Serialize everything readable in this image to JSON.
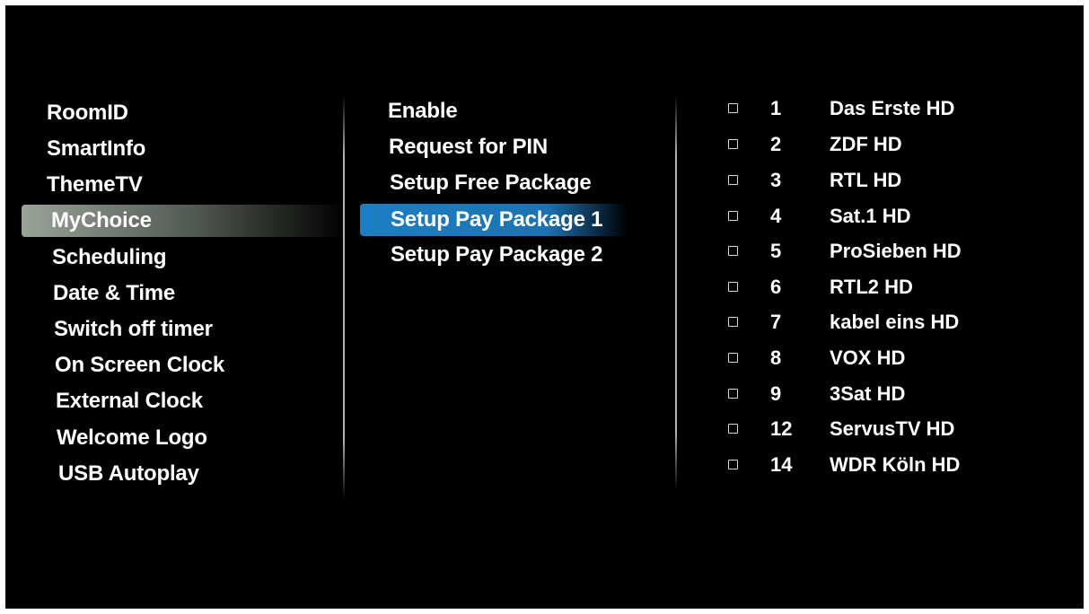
{
  "settings_menu": {
    "items": [
      {
        "label": "RoomID"
      },
      {
        "label": "SmartInfo"
      },
      {
        "label": "ThemeTV"
      },
      {
        "label": "MyChoice",
        "selected": true
      },
      {
        "label": "Scheduling"
      },
      {
        "label": "Date & Time"
      },
      {
        "label": "Switch off timer"
      },
      {
        "label": "On Screen Clock"
      },
      {
        "label": "External Clock"
      },
      {
        "label": "Welcome Logo"
      },
      {
        "label": "USB Autoplay"
      }
    ]
  },
  "mychoice_menu": {
    "items": [
      {
        "label": "Enable"
      },
      {
        "label": "Request for PIN"
      },
      {
        "label": "Setup Free Package"
      },
      {
        "label": "Setup Pay Package 1",
        "selected": true
      },
      {
        "label": "Setup Pay Package 2"
      }
    ]
  },
  "channel_list": {
    "channels": [
      {
        "number": "1",
        "name": "Das Erste HD",
        "checked": false
      },
      {
        "number": "2",
        "name": "ZDF HD",
        "checked": false
      },
      {
        "number": "3",
        "name": "RTL HD",
        "checked": false
      },
      {
        "number": "4",
        "name": "Sat.1 HD",
        "checked": false
      },
      {
        "number": "5",
        "name": "ProSieben HD",
        "checked": false
      },
      {
        "number": "6",
        "name": "RTL2 HD",
        "checked": false
      },
      {
        "number": "7",
        "name": "kabel eins HD",
        "checked": false
      },
      {
        "number": "8",
        "name": "VOX HD",
        "checked": false
      },
      {
        "number": "9",
        "name": "3Sat HD",
        "checked": false
      },
      {
        "number": "12",
        "name": "ServusTV HD",
        "checked": false
      },
      {
        "number": "14",
        "name": "WDR Köln HD",
        "checked": false
      }
    ]
  },
  "colors": {
    "background": "#000000",
    "text": "#ffffff",
    "left_selection": "#8a938a",
    "mid_selection": "#1c7fc4"
  }
}
